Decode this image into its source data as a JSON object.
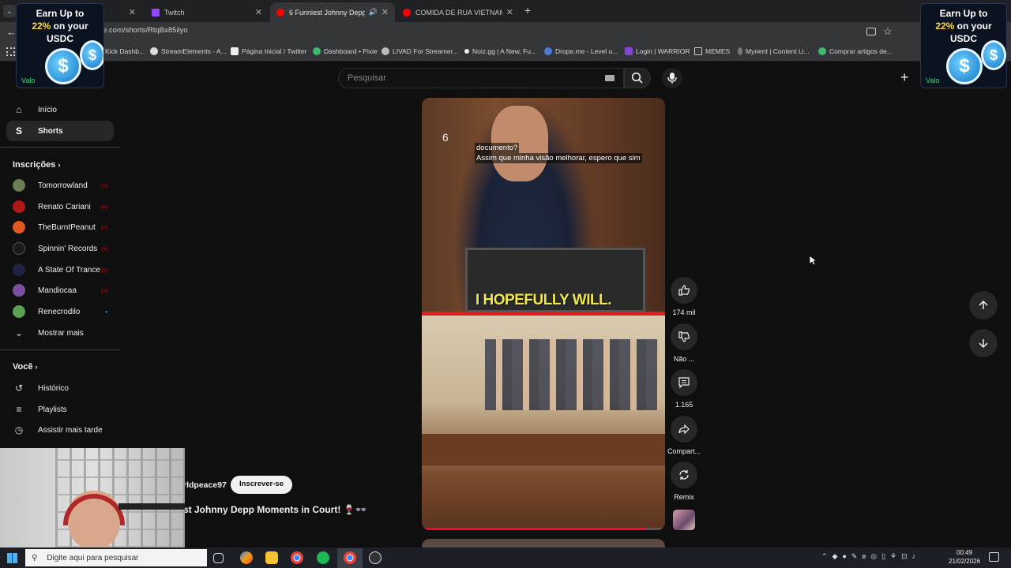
{
  "tabs": [
    {
      "label": "",
      "favicon_color": "#3b5bdb"
    },
    {
      "label": "Twitch",
      "favicon_color": "#9146ff"
    },
    {
      "label": "6 Funniest Johnny Depp M",
      "favicon_color": "#ff0000"
    },
    {
      "label": "COMIDA DE RUA VIETNAMITA",
      "favicon_color": "#ff0000"
    }
  ],
  "address": {
    "url": "e.com/shorts/RtqBx85ilyo"
  },
  "bookmarks": [
    {
      "label": "Kick Dashb..."
    },
    {
      "label": "StreamElements - A..."
    },
    {
      "label": "Página Inicial / Twitter"
    },
    {
      "label": "Dashboard • Pixie"
    },
    {
      "label": "LIVAD For Streamer..."
    },
    {
      "label": "Noiz.gg | A New, Fu..."
    },
    {
      "label": "Drope.me - Level u..."
    },
    {
      "label": "Login | WARRIOR"
    },
    {
      "label": "MEMES"
    },
    {
      "label": "Myrient | Content Li..."
    },
    {
      "label": "Comprar artigos de..."
    }
  ],
  "ads": {
    "line1": "Earn Up to",
    "pct": "22%",
    "line2": " on your",
    "line3": "USDC",
    "footer": "Valo"
  },
  "search": {
    "placeholder": "Pesquisar"
  },
  "sidebar": {
    "home": "Início",
    "shorts": "Shorts",
    "subs_title": "Inscrições",
    "subs": [
      {
        "name": "Tomorrowland",
        "color": "#6b7d52",
        "live": "(•)"
      },
      {
        "name": "Renato Cariani",
        "color": "#b01818",
        "live": "(•)"
      },
      {
        "name": "TheBurntPeanut",
        "color": "#e05a20",
        "live": "(•)"
      },
      {
        "name": "Spinnin' Records",
        "color": "#1a1a1a",
        "live": "(•)"
      },
      {
        "name": "A State Of Trance",
        "color": "#222244",
        "live": "(•)"
      },
      {
        "name": "Mandiocaa",
        "color": "#7a4fa0",
        "live": "(•)"
      },
      {
        "name": "Renecrodilo",
        "color": "#5aa050",
        "live": "•"
      }
    ],
    "more": "Mostrar mais",
    "you_title": "Você",
    "you": [
      "Histórico",
      "Playlists",
      "Assistir mais tarde"
    ]
  },
  "video": {
    "number": "6",
    "sub1": "documento?",
    "sub2": "Assim que minha visão melhorar, espero que sim",
    "caption": "I HOPEFULLY WILL.",
    "channel": "rldpeace97",
    "subscribe": "Inscrever-se",
    "title": "st Johnny Depp Moments in Court! 🍷👓"
  },
  "actions": {
    "like": "174 mil",
    "dislike": "Não ...",
    "comments": "1.165",
    "share": "Compart...",
    "remix": "Remix"
  },
  "taskbar": {
    "search": "Digite aqui para pesquisar",
    "time": "00:49",
    "date": "21/02/2026"
  }
}
